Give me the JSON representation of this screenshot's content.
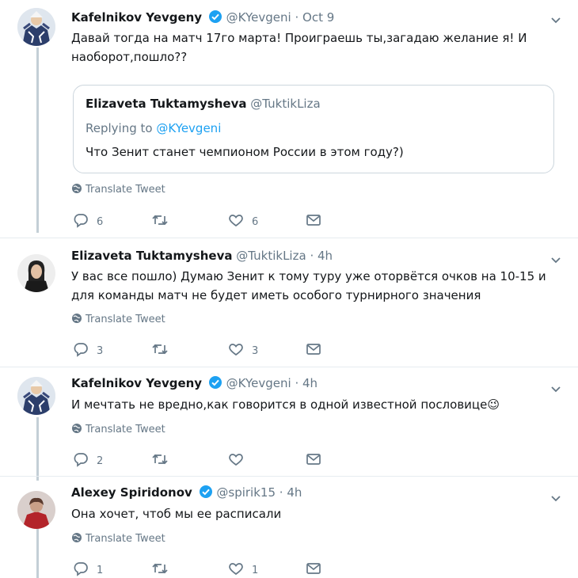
{
  "tweets": [
    {
      "name": "Kafelnikov Yevgeny",
      "handle": "@KYevgeni",
      "dot": "·",
      "time": "Oct 9",
      "text": "Давай тогда на матч 17го марта! Проиграешь ты,загадаю желание я! И наоборот,пошло??",
      "translate": "Translate Tweet",
      "reply_count": "6",
      "retweet_count": "",
      "like_count": "6",
      "verified": true,
      "quote": {
        "name": "Elizaveta Tuktamysheva",
        "handle": "@TuktikLiza",
        "replying_prefix": "Replying to",
        "replying_handle": "@KYevgeni",
        "text": "Что Зенит станет чемпионом России в этом году?)"
      }
    },
    {
      "name": "Elizaveta Tuktamysheva",
      "handle": "@TuktikLiza",
      "dot": "·",
      "time": "4h",
      "text": "У вас все пошло) Думаю Зенит к тому туру уже оторвётся очков на 10-15 и для команды матч не будет иметь особого турнирного значения",
      "translate": "Translate Tweet",
      "reply_count": "3",
      "retweet_count": "",
      "like_count": "3",
      "verified": false
    },
    {
      "name": "Kafelnikov Yevgeny",
      "handle": "@KYevgeni",
      "dot": "·",
      "time": "4h",
      "text": "И мечтать не вредно,как говорится в одной известной пословице",
      "emoji": "😉",
      "translate": "Translate Tweet",
      "reply_count": "2",
      "retweet_count": "",
      "like_count": "",
      "verified": true
    },
    {
      "name": "Alexey Spiridonov",
      "handle": "@spirik15",
      "dot": "·",
      "time": "4h",
      "text": "Она хочет, чтоб мы ее расписали",
      "translate": "Translate Tweet",
      "reply_count": "1",
      "retweet_count": "",
      "like_count": "1",
      "verified": true
    }
  ],
  "colors": {
    "accent": "#1da1f2",
    "secondary_text": "#657786",
    "border": "#ccd6dd",
    "thread_line": "#c4cfd6"
  },
  "icons": [
    "verified-badge-icon",
    "chevron-down-icon",
    "globe-icon",
    "reply-icon",
    "retweet-icon",
    "like-icon",
    "direct-message-icon"
  ]
}
